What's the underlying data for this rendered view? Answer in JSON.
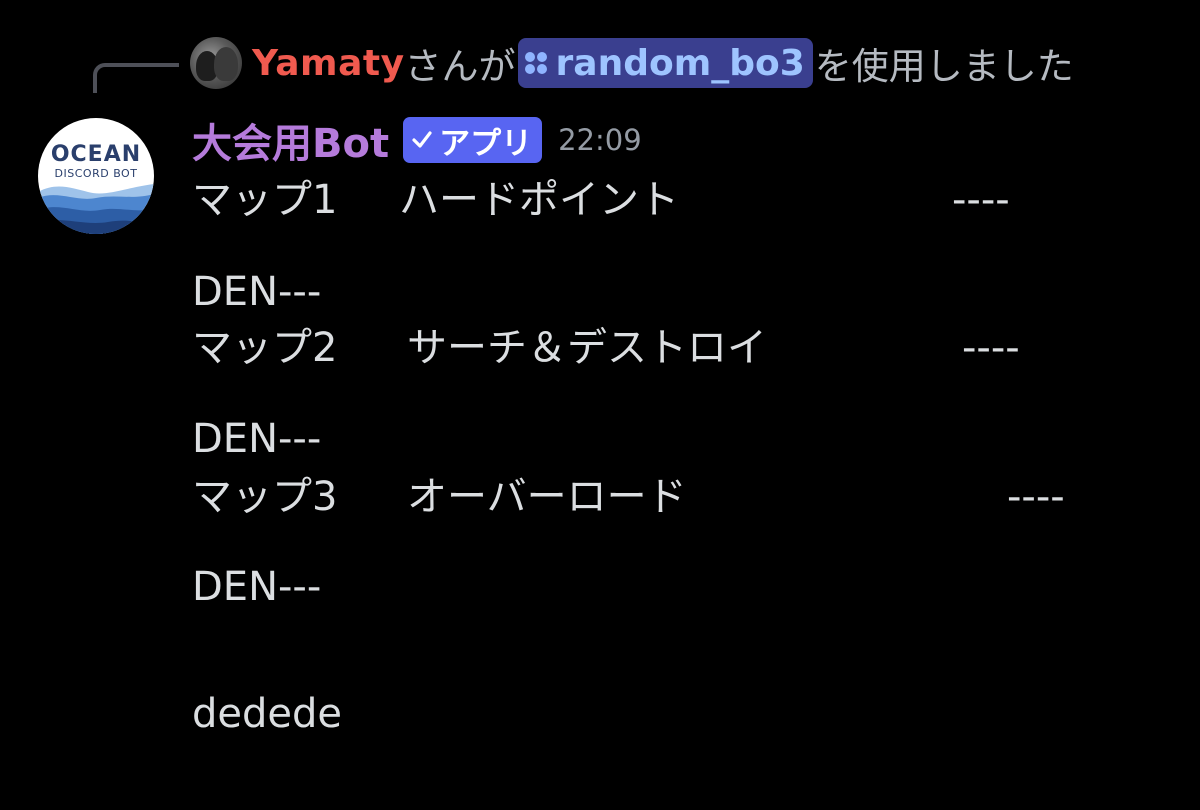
{
  "reply": {
    "username": "Yamaty",
    "text_before": "さんが",
    "command_icon": "app-command-icon",
    "command_name": "random_bo3",
    "text_after": "を使用しました"
  },
  "message": {
    "author": "大会用Bot",
    "tag_icon": "check-icon",
    "tag_label": "アプリ",
    "timestamp": "22:09",
    "avatar": {
      "title": "OCEAN",
      "subtitle": "DISCORD BOT"
    },
    "rows": [
      {
        "map": "マップ1",
        "mode": "ハードポイント",
        "result": "----",
        "team": "DEN---"
      },
      {
        "map": "マップ2",
        "mode": "サーチ＆デストロイ",
        "result": "----",
        "team": "DEN---"
      },
      {
        "map": "マップ3",
        "mode": "オーバーロード",
        "result": "----",
        "team": "DEN---"
      }
    ],
    "footer": "dedede"
  },
  "colors": {
    "background": "#000000",
    "reply_username": "#f05a4f",
    "bot_name": "#b57bdb",
    "app_tag": "#5865f2",
    "command_chip": "#3a3f8f",
    "text": "#dbdee1",
    "muted": "#949ba4"
  }
}
